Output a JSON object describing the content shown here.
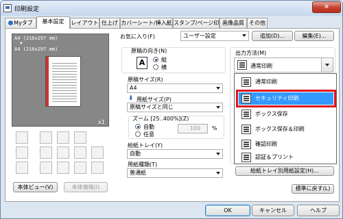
{
  "window": {
    "title": "印刷設定",
    "close_glyph": "✕"
  },
  "tabs": [
    "Myタブ",
    "基本設定",
    "レイアウト",
    "仕上げ",
    "カバーシート/挿入紙",
    "スタンプ/ページ印字",
    "画像品質",
    "その他"
  ],
  "preview": {
    "size_line1": "A4 (210x297 mm)",
    "arrow": "▼",
    "size_line2": "A4 (210x297 mm)",
    "copies": "x1"
  },
  "left_buttons": {
    "body_view": "本体ビュー(V)",
    "body_info": "本体情報(I)"
  },
  "favorites": {
    "label": "お気に入り(F)",
    "value": "ユーザー設定",
    "add": "追加(D)...",
    "edit": "編集(E)..."
  },
  "orientation": {
    "label": "原稿の向き(N)",
    "portrait": "縦",
    "landscape": "横"
  },
  "original_size": {
    "label": "原稿サイズ(R)",
    "value": "A4"
  },
  "paper_size": {
    "label": "用紙サイズ(P)",
    "value": "原稿サイズと同じ"
  },
  "zoom": {
    "label": "ズーム [25..400%](Z)",
    "auto": "自動",
    "manual": "任意",
    "value": "100",
    "unit": "%"
  },
  "paper_tray": {
    "label": "給紙トレイ(Y)",
    "value": "自動"
  },
  "paper_type": {
    "label": "用紙種類(T)",
    "value": "普通紙"
  },
  "output": {
    "label": "出力方法(M)",
    "value": "通常印刷",
    "options": [
      "通常印刷",
      "セキュリティ印刷",
      "ボックス保存",
      "ボックス保存＆印刷",
      "確認印刷",
      "認証＆プリント"
    ],
    "selected_index": 1
  },
  "tray_settings": "給紙トレイ別用紙設定(H)...",
  "restore_defaults": "標準に戻す(L)",
  "footer": {
    "ok": "OK",
    "cancel": "キャンセル",
    "help": "ヘルプ"
  },
  "colors": {
    "highlight": "#3399ff",
    "red_frame": "#e0141b"
  }
}
